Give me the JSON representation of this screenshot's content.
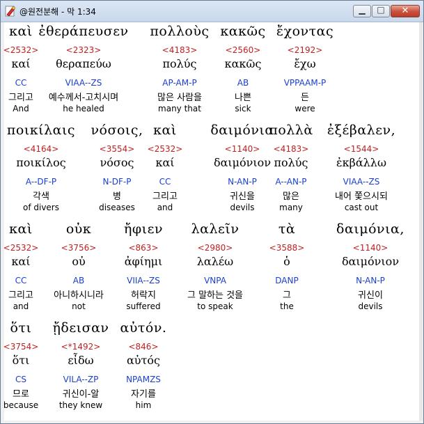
{
  "window": {
    "title": "@원전분해 - 막 1:34",
    "minimize": "▁",
    "maximize": "□",
    "close": "✕"
  },
  "rows": [
    {
      "words": [
        {
          "greek": "καὶ",
          "strong": "<2532>",
          "lemma": "καί",
          "parse": "CC",
          "korean": "그리고",
          "english": "And"
        },
        {
          "greek": "ἐθεράπευσεν",
          "strong": "<2323>",
          "lemma": "θεραπεύω",
          "parse": "VIAA--ZS",
          "korean": "예수께서-고치시며",
          "english": "he healed"
        },
        {
          "greek": "πολλοὺς",
          "strong": "<4183>",
          "lemma": "πολύς",
          "parse": "AP-AM-P",
          "korean": "많은 사람을",
          "english": "many that"
        },
        {
          "greek": "κακῶς",
          "strong": "<2560>",
          "lemma": "κακῶς",
          "parse": "AB",
          "korean": "나쁜",
          "english": "sick"
        },
        {
          "greek": "ἔχοντας",
          "strong": "<2192>",
          "lemma": "ἔχω",
          "parse": "VPPAAM-P",
          "korean": "든",
          "english": "were"
        }
      ]
    },
    {
      "words": [
        {
          "greek": "ποικίλαις",
          "strong": "<4164>",
          "lemma": "ποικίλος",
          "parse": "A--DF-P",
          "korean": "각색",
          "english": "of divers"
        },
        {
          "greek": "νόσοις,",
          "strong": "<3554>",
          "lemma": "νόσος",
          "parse": "N-DF-P",
          "korean": "병",
          "english": "diseases"
        },
        {
          "greek": "καὶ",
          "strong": "<2532>",
          "lemma": "καί",
          "parse": "CC",
          "korean": "그리고",
          "english": "and"
        },
        {
          "greek": "δαιμόνια",
          "strong": "<1140>",
          "lemma": "δαιμόνιον",
          "parse": "N-AN-P",
          "korean": "귀신을",
          "english": "devils"
        },
        {
          "greek": "πολλὰ",
          "strong": "<4183>",
          "lemma": "πολύς",
          "parse": "A--AN-P",
          "korean": "많은",
          "english": "many"
        },
        {
          "greek": "ἐξέβαλεν,",
          "strong": "<1544>",
          "lemma": "ἐκβάλλω",
          "parse": "VIAA--ZS",
          "korean": "내어 쫓으시되",
          "english": "cast out"
        }
      ]
    },
    {
      "words": [
        {
          "greek": "καὶ",
          "strong": "<2532>",
          "lemma": "καί",
          "parse": "CC",
          "korean": "그리고",
          "english": "and"
        },
        {
          "greek": "οὐκ",
          "strong": "<3756>",
          "lemma": "οὐ",
          "parse": "AB",
          "korean": "아니하시니라",
          "english": "not"
        },
        {
          "greek": "ἤφιεν",
          "strong": "<863>",
          "lemma": "ἀφίημι",
          "parse": "VIIA--ZS",
          "korean": "허락지",
          "english": "suffered"
        },
        {
          "greek": "λαλεῖν",
          "strong": "<2980>",
          "lemma": "λαλέω",
          "parse": "VNPA",
          "korean": "그 말하는 것을",
          "english": "to speak"
        },
        {
          "greek": "τὰ",
          "strong": "<3588>",
          "lemma": "ὁ",
          "parse": "DANP",
          "korean": "그",
          "english": "the"
        },
        {
          "greek": "δαιμόνια,",
          "strong": "<1140>",
          "lemma": "δαιμόνιον",
          "parse": "N-AN-P",
          "korean": "귀신이",
          "english": "devils"
        }
      ]
    },
    {
      "words": [
        {
          "greek": "ὅτι",
          "strong": "<3754>",
          "lemma": "ὅτι",
          "parse": "CS",
          "korean": "므로",
          "english": "because"
        },
        {
          "greek": "ᾔδεισαν",
          "strong": "<*1492>",
          "lemma": "εἶδω",
          "parse": "VILA--ZP",
          "korean": "귀신이-알",
          "english": "they knew"
        },
        {
          "greek": "αὐτόν.",
          "strong": "<846>",
          "lemma": "αὐτός",
          "parse": "NPAMZS",
          "korean": "자기를",
          "english": "him"
        }
      ]
    }
  ]
}
